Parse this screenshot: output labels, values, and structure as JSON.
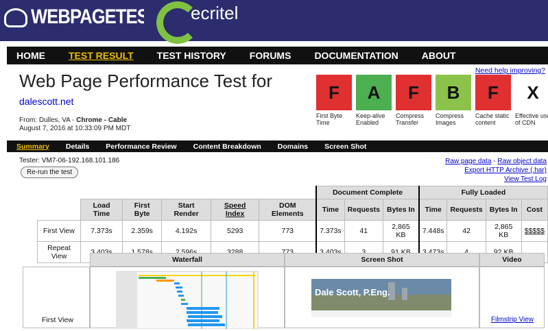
{
  "header": {
    "logo_text": "WEBPAGETEST",
    "sponsor_text": "ecritel"
  },
  "nav": [
    "HOME",
    "TEST RESULT",
    "TEST HISTORY",
    "FORUMS",
    "DOCUMENTATION",
    "ABOUT"
  ],
  "help_link": "Need help improving?",
  "title": "Web Page Performance Test for",
  "site": "dalescott.net",
  "from_prefix": "From: Dulles, VA - ",
  "from_bold": "Chrome - Cable",
  "date": "August 7, 2016 at 10:33:09 PM MDT",
  "grades": [
    {
      "grade": "F",
      "color": "#e03030",
      "label": "First Byte Time"
    },
    {
      "grade": "A",
      "color": "#4caf50",
      "label": "Keep-alive Enabled"
    },
    {
      "grade": "F",
      "color": "#e03030",
      "label": "Compress Transfer"
    },
    {
      "grade": "B",
      "color": "#8bc34a",
      "label": "Compress Images"
    },
    {
      "grade": "F",
      "color": "#e03030",
      "label": "Cache static content"
    },
    {
      "grade": "X",
      "color": "#ffffff",
      "label": "Effective use of CDN"
    }
  ],
  "subnav": [
    "Summary",
    "Details",
    "Performance Review",
    "Content Breakdown",
    "Domains",
    "Screen Shot"
  ],
  "tester": "Tester: VM7-06-192.168.101.186",
  "rerun": "Re-run the test",
  "raw_page": "Raw page data",
  "raw_sep": " - ",
  "raw_object": "Raw object data",
  "export": "Export HTTP Archive (.har)",
  "view_log": "View Test Log",
  "table": {
    "group_doc": "Document Complete",
    "group_full": "Fully Loaded",
    "headers": [
      "Load Time",
      "First Byte",
      "Start Render",
      "Speed Index",
      "DOM Elements",
      "Time",
      "Requests",
      "Bytes In",
      "Time",
      "Requests",
      "Bytes In",
      "Cost"
    ],
    "rows": [
      {
        "label": "First View",
        "cells": [
          "7.373s",
          "2.359s",
          "4.192s",
          "5293",
          "773",
          "7.373s",
          "41",
          "2,865 KB",
          "7.448s",
          "42",
          "2,865 KB",
          "$$$$$"
        ]
      },
      {
        "label": "Repeat View",
        "cells": [
          "3.403s",
          "1.578s",
          "2.596s",
          "3288",
          "773",
          "3.403s",
          "3",
          "91 KB",
          "3.473s",
          "4",
          "92 KB",
          ""
        ]
      }
    ]
  },
  "waterfall": {
    "h1": "Waterfall",
    "h2": "Screen Shot",
    "h3": "Video",
    "row_label": "First View",
    "filmstrip": "Filmstrip View",
    "screenshot_title": "Dale Scott, P.Eng."
  }
}
